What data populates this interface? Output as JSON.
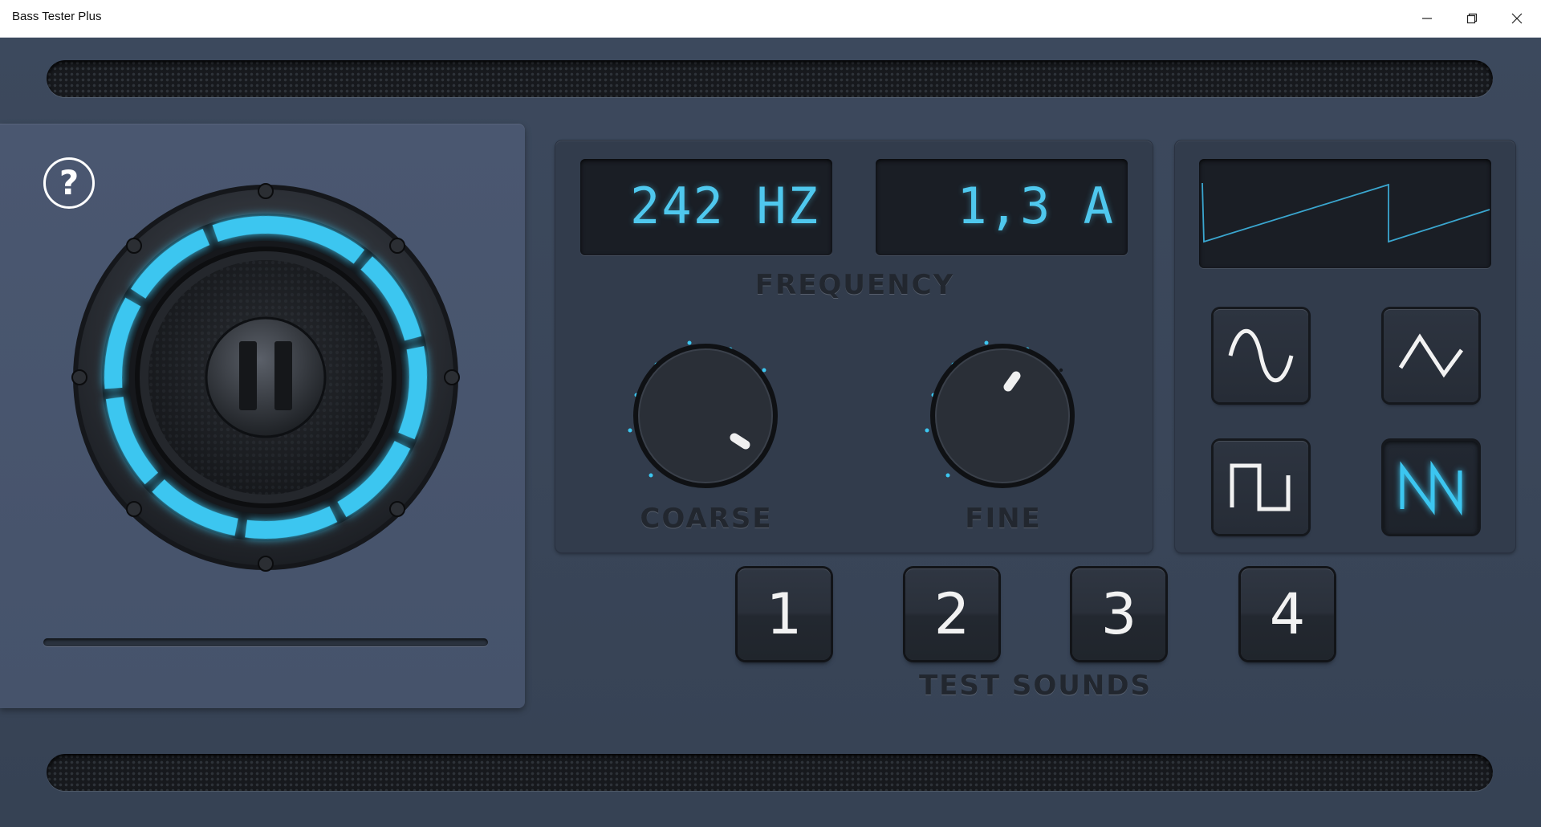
{
  "window": {
    "title": "Bass Tester Plus",
    "controls": [
      "minimize-icon",
      "restore-icon",
      "close-icon"
    ]
  },
  "help": {
    "label": "?"
  },
  "player": {
    "state": "playing",
    "button_icon": "pause-icon",
    "progress": 0
  },
  "frequency": {
    "display_value": "242 HZ",
    "amplitude_display": "1,3 A",
    "label": "FREQUENCY",
    "coarse_label": "COARSE",
    "fine_label": "FINE"
  },
  "waveforms": {
    "options": [
      "sine-wave-icon",
      "triangle-wave-icon",
      "square-wave-icon",
      "sawtooth-wave-icon"
    ],
    "selected": "sawtooth-wave-icon"
  },
  "test_sounds": {
    "label": "TEST SOUNDS",
    "buttons": [
      "1",
      "2",
      "3",
      "4"
    ]
  },
  "colors": {
    "accent": "#3fc3ec",
    "panel": "#323c4c",
    "background": "#3a475a",
    "lcd": "#1a1e25"
  }
}
